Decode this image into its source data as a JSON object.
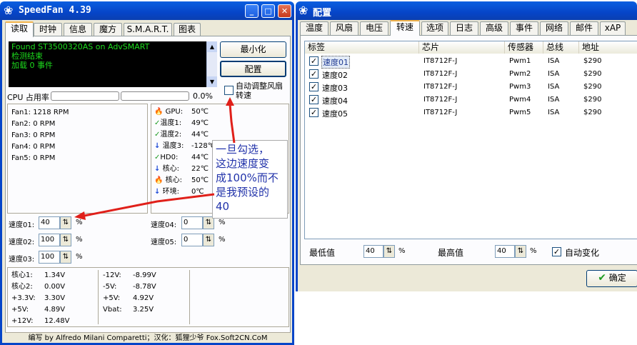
{
  "main_window": {
    "title": "SpeedFan 4.39",
    "tabs": [
      "读取",
      "时钟",
      "信息",
      "魔方",
      "S.M.A.R.T.",
      "图表"
    ],
    "log_lines": [
      "Found ST3500320AS on AdvSMART",
      "检测结束",
      "加载 0 事件"
    ],
    "minimize_label": "最小化",
    "config_label": "配置",
    "cpu_usage_label": "CPU 占用率",
    "cpu_usage_value": "0.0%",
    "auto_fan_label": "自动调整风扇转速",
    "fans": [
      "Fan1: 1218 RPM",
      "Fan2: 0 RPM",
      "Fan3: 0 RPM",
      "Fan4: 0 RPM",
      "Fan5: 0 RPM"
    ],
    "temps": [
      {
        "icon": "flame-icon",
        "label": "GPU:",
        "value": "50℃"
      },
      {
        "icon": "check-icon",
        "label": "温度1:",
        "value": "49℃"
      },
      {
        "icon": "check-icon",
        "label": "温度2:",
        "value": "44℃"
      },
      {
        "icon": "arrow-down-icon",
        "label": "温度3:",
        "value": "-128℃"
      },
      {
        "icon": "check-icon",
        "label": "HD0:",
        "value": "44℃"
      },
      {
        "icon": "arrow-down-icon",
        "label": "核心:",
        "value": "22℃"
      },
      {
        "icon": "flame-icon",
        "label": "核心:",
        "value": "50℃"
      },
      {
        "icon": "arrow-down-icon",
        "label": "环境:",
        "value": "0℃"
      }
    ],
    "speeds": [
      {
        "label": "速度01:",
        "value": "40",
        "unit": "%"
      },
      {
        "label": "速度02:",
        "value": "100",
        "unit": "%"
      },
      {
        "label": "速度03:",
        "value": "100",
        "unit": "%"
      },
      {
        "label": "速度04:",
        "value": "0",
        "unit": "%"
      },
      {
        "label": "速度05:",
        "value": "0",
        "unit": "%"
      }
    ],
    "voltages_col1": [
      "核心1:",
      "核心2:",
      "+3.3V:",
      "+5V:",
      "+12V:"
    ],
    "voltages_col1_vals": [
      "1.34V",
      "0.00V",
      "3.30V",
      "4.89V",
      "12.48V"
    ],
    "voltages_col2": [
      "-12V:",
      "-5V:",
      "+5V:",
      "Vbat:"
    ],
    "voltages_col2_vals": [
      "-8.99V",
      "-8.78V",
      "4.92V",
      "3.25V"
    ],
    "status_bar": "编写 by Alfredo Milani Comparetti；汉化：狐狸少爷 Fox.Soft2CN.CoM"
  },
  "annotation": {
    "text_lines": [
      "一旦勾选，",
      "这边速度变",
      "成100%而不",
      "是我预设的",
      "40"
    ],
    "color": "#2233aa",
    "arrow_color": "#e0201a"
  },
  "config_window": {
    "title": "配置",
    "tabs": [
      "温度",
      "风扇",
      "电压",
      "转速",
      "选项",
      "日志",
      "高级",
      "事件",
      "网络",
      "邮件",
      "xAP"
    ],
    "columns": [
      "标签",
      "芯片",
      "传感器",
      "总线",
      "地址"
    ],
    "rows": [
      {
        "label": "速度01",
        "chip": "IT8712F-J",
        "sensor": "Pwm1",
        "bus": "ISA",
        "addr": "$290"
      },
      {
        "label": "速度02",
        "chip": "IT8712F-J",
        "sensor": "Pwm2",
        "bus": "ISA",
        "addr": "$290"
      },
      {
        "label": "速度03",
        "chip": "IT8712F-J",
        "sensor": "Pwm3",
        "bus": "ISA",
        "addr": "$290"
      },
      {
        "label": "速度04",
        "chip": "IT8712F-J",
        "sensor": "Pwm4",
        "bus": "ISA",
        "addr": "$290"
      },
      {
        "label": "速度05",
        "chip": "IT8712F-J",
        "sensor": "Pwm5",
        "bus": "ISA",
        "addr": "$290"
      }
    ],
    "min_label": "最低值",
    "min_value": "40",
    "max_label": "最高值",
    "max_value": "40",
    "percent": "%",
    "auto_change_label": "自动变化",
    "ok_label": "确定"
  }
}
